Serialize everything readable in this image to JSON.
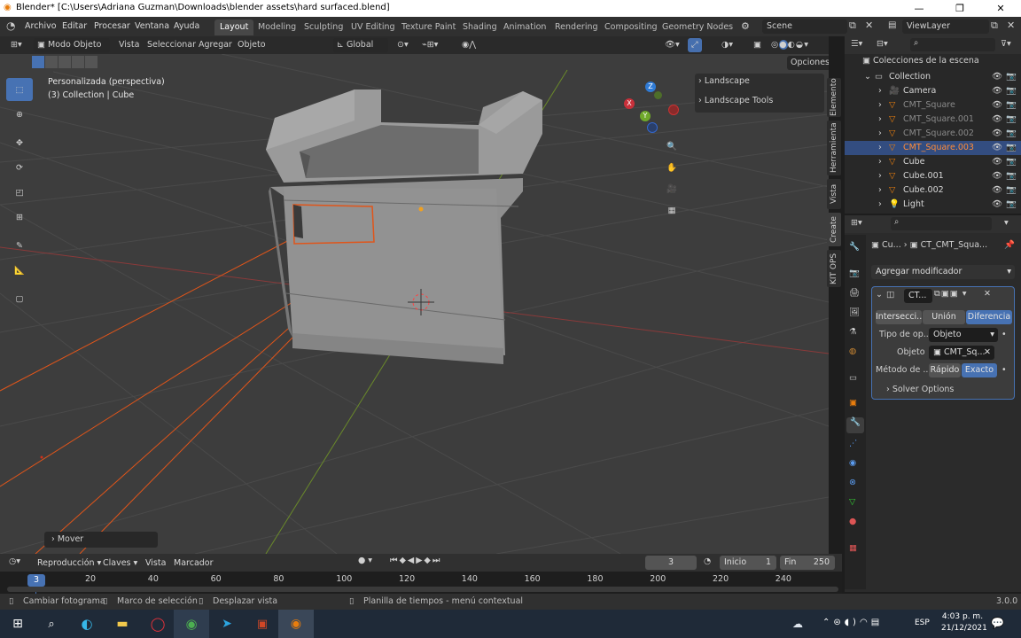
{
  "window": {
    "title": "Blender* [C:\\Users\\Adriana Guzman\\Downloads\\blender assets\\hard surfaced.blend]",
    "minimize": "—",
    "maximize": "❐",
    "close": "✕"
  },
  "menu": [
    "Archivo",
    "Editar",
    "Procesar",
    "Ventana",
    "Ayuda"
  ],
  "workspaces": [
    "Layout",
    "Modeling",
    "Sculpting",
    "UV Editing",
    "Texture Paint",
    "Shading",
    "Animation",
    "Rendering",
    "Compositing",
    "Geometry Nodes"
  ],
  "scene": "Scene",
  "viewlayer": "ViewLayer",
  "viewport": {
    "mode": "Modo Objeto",
    "menus": [
      "Vista",
      "Seleccionar",
      "Agregar",
      "Objeto"
    ],
    "orientation": "Global",
    "options": "Opciones",
    "overlay_title": "Personalizada (perspectiva)",
    "overlay_sub": "(3) Collection | Cube",
    "npanel": [
      "Landscape",
      "Landscape Tools"
    ],
    "sidetabs": [
      "Elemento",
      "Herramienta",
      "Vista",
      "Create",
      "KIT OPS"
    ],
    "last_op": "Mover",
    "gizmo": {
      "x": "X",
      "y": "Y",
      "z": "Z"
    }
  },
  "outliner": {
    "header": "Colecciones de la escena",
    "items": [
      {
        "name": "Collection",
        "depth": 0,
        "type": "collection",
        "active": false
      },
      {
        "name": "Camera",
        "depth": 1,
        "type": "camera",
        "active": false
      },
      {
        "name": "CMT_Square",
        "depth": 1,
        "type": "mesh",
        "active": false
      },
      {
        "name": "CMT_Square.001",
        "depth": 1,
        "type": "mesh",
        "active": false
      },
      {
        "name": "CMT_Square.002",
        "depth": 1,
        "type": "mesh",
        "active": false
      },
      {
        "name": "CMT_Square.003",
        "depth": 1,
        "type": "mesh",
        "active": true
      },
      {
        "name": "Cube",
        "depth": 1,
        "type": "mesh",
        "active": false
      },
      {
        "name": "Cube.001",
        "depth": 1,
        "type": "mesh",
        "active": false
      },
      {
        "name": "Cube.002",
        "depth": 1,
        "type": "mesh",
        "active": false
      },
      {
        "name": "Light",
        "depth": 1,
        "type": "light",
        "active": false
      }
    ]
  },
  "properties": {
    "breadcrumb_a": "Cu...",
    "breadcrumb_b": "CT_CMT_Squa...",
    "add_modifier": "Agregar modificador",
    "mod_name": "CT...",
    "ops": [
      "Intersecci...",
      "Unión",
      "Diferencia"
    ],
    "op_type_label": "Tipo de op...",
    "op_type_value": "Objeto",
    "object_label": "Objeto",
    "object_value": "CMT_Sq...",
    "method_label": "Método de ...",
    "methods": [
      "Rápido",
      "Exacto"
    ],
    "solver": "Solver Options"
  },
  "timeline": {
    "playback": "Reproducción",
    "keys": "Claves",
    "view": "Vista",
    "marker": "Marcador",
    "current": "3",
    "start_label": "Inicio",
    "start": "1",
    "end_label": "Fin",
    "end": "250",
    "ticks": [
      "20",
      "40",
      "60",
      "80",
      "100",
      "120",
      "140",
      "160",
      "180",
      "200",
      "220",
      "240"
    ],
    "frame_badge": "3"
  },
  "status": {
    "a": "Cambiar fotograma",
    "b": "Marco de selección",
    "c": "Desplazar vista",
    "d": "Planilla de tiempos - menú contextual",
    "version": "3.0.0"
  },
  "taskbar": {
    "lang": "ESP",
    "time": "4:03 p. m.",
    "date": "21/12/2021"
  },
  "colors": {
    "accent": "#4772b3",
    "selected": "#e05a1f",
    "bg": "#3d3d3d"
  }
}
